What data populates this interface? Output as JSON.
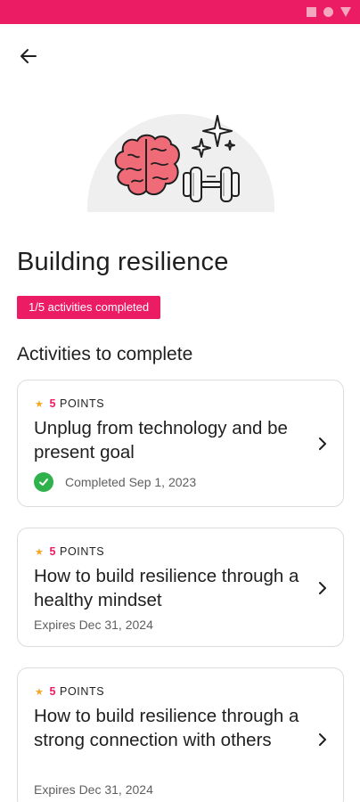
{
  "status_bar": {
    "color": "#ec1c64",
    "icons": [
      "square-icon",
      "circle-icon",
      "triangle-icon"
    ]
  },
  "header": {
    "back_icon": "back-arrow-icon"
  },
  "hero": {
    "image": "brain-and-dumbbell-illustration"
  },
  "page": {
    "title": "Building resilience",
    "progress_badge": "1/5 activities completed",
    "progress": {
      "completed": 1,
      "total": 5
    },
    "section_title": "Activities to complete"
  },
  "activities": [
    {
      "points_value": "5",
      "points_label": "POINTS",
      "title": "Unplug from technology and be present goal",
      "status": "Completed Sep 1, 2023",
      "completed": true
    },
    {
      "points_value": "5",
      "points_label": "POINTS",
      "title": "How to build resilience through a healthy mindset",
      "status": "Expires Dec 31, 2024",
      "completed": false
    },
    {
      "points_value": "5",
      "points_label": "POINTS",
      "title": "How to build resilience through a strong connection with others",
      "status": "Expires Dec 31, 2024",
      "completed": false
    }
  ],
  "colors": {
    "accent": "#ec1c64",
    "success": "#2fb24c",
    "star": "#f5a623"
  }
}
